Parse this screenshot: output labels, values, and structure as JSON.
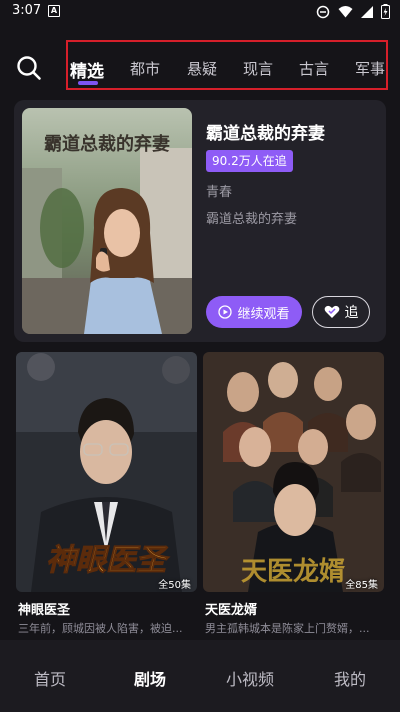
{
  "status_bar": {
    "time": "3:07",
    "notification_letter": "A"
  },
  "categories": {
    "tabs": [
      "精选",
      "都市",
      "悬疑",
      "现言",
      "古言",
      "军事"
    ],
    "active": "精选"
  },
  "featured": {
    "title": "霸道总裁的弃妻",
    "poster_text": "霸道总裁的弃妻",
    "followers_badge": "90.2万人在追",
    "genre": "青春",
    "description": "霸道总裁的弃妻",
    "continue_label": "继续观看",
    "follow_label": "追"
  },
  "dramas": [
    {
      "title": "神眼医圣",
      "poster_text": "神眼医圣",
      "episodes": "全50集",
      "description": "三年前，顾城因被人陷害，被迫..."
    },
    {
      "title": "天医龙婿",
      "poster_text": "天医龙婿",
      "episodes": "全85集",
      "description": "男主孤韩城本是陈家上门赘婿，..."
    }
  ],
  "bottom_nav": {
    "items": [
      "首页",
      "剧场",
      "小视频",
      "我的"
    ],
    "active": "剧场"
  },
  "colors": {
    "accent": "#8e5cf6",
    "highlight_box": "#d61f2a",
    "background": "#151418"
  }
}
